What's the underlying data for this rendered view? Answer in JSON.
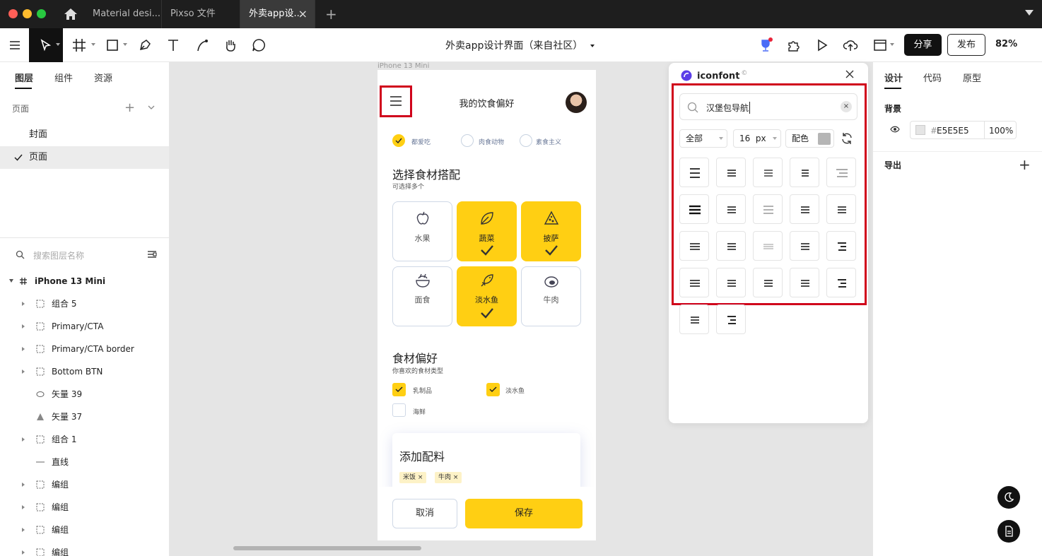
{
  "window": {
    "tabs": [
      {
        "label": "Material desi..."
      },
      {
        "label": "Pixso 文件"
      },
      {
        "label": "外卖app设...",
        "close": "×"
      }
    ],
    "new_tab": "+"
  },
  "toolbar": {
    "doc_title": "外卖app设计界面（来自社区）",
    "share_label": "分享",
    "publish_label": "发布",
    "zoom": "82%"
  },
  "left_panel": {
    "tabs": [
      "图层",
      "组件",
      "资源"
    ],
    "pages_header": "页面",
    "pages_add": "+",
    "pages": [
      "封面",
      "页面"
    ],
    "search_placeholder": "搜索图层名称",
    "layers": [
      {
        "name": "iPhone 13 Mini"
      },
      {
        "name": "组合 5"
      },
      {
        "name": "Primary/CTA"
      },
      {
        "name": "Primary/CTA border"
      },
      {
        "name": "Bottom BTN"
      },
      {
        "name": "矢量 39"
      },
      {
        "name": "矢量 37"
      },
      {
        "name": "组合 1"
      },
      {
        "name": "直线"
      },
      {
        "name": "编组"
      },
      {
        "name": "编组"
      },
      {
        "name": "编组"
      },
      {
        "name": "编组"
      }
    ]
  },
  "canvas": {
    "frame_label": "iPhone 13 Mini",
    "phone": {
      "title": "我的饮食偏好",
      "diet_options": [
        {
          "label": "都爱吃",
          "selected": true
        },
        {
          "label": "肉食动物",
          "selected": false
        },
        {
          "label": "素食主义",
          "selected": false
        }
      ],
      "ingredients_title": "选择食材搭配",
      "ingredients_sub": "可选择多个",
      "ingredients": [
        {
          "label": "水果",
          "icon": "apple-icon",
          "selected": false
        },
        {
          "label": "蔬菜",
          "icon": "leaf-icon",
          "selected": true
        },
        {
          "label": "披萨",
          "icon": "pizza-icon",
          "selected": true
        },
        {
          "label": "面食",
          "icon": "noodle-bowl-icon",
          "selected": false
        },
        {
          "label": "淡水鱼",
          "icon": "fish-icon",
          "selected": true
        },
        {
          "label": "牛肉",
          "icon": "steak-icon",
          "selected": false
        }
      ],
      "prefs_title": "食材偏好",
      "prefs_sub": "你喜欢的食材类型",
      "prefs": [
        {
          "label": "乳制品",
          "checked": true
        },
        {
          "label": "淡水鱼",
          "checked": true
        },
        {
          "label": "海鲜",
          "checked": false
        }
      ],
      "addon_title": "添加配料",
      "addon_chips": [
        "米饭",
        "牛肉"
      ],
      "chip_remove": "×",
      "cancel_label": "取消",
      "save_label": "保存"
    }
  },
  "plugin": {
    "title": "iconfont",
    "title_mark": "©",
    "search_value": "汉堡包导航",
    "clear_label": "×",
    "filter_all": "全部",
    "size_value": "16",
    "size_unit": "px",
    "color_label": "配色",
    "icon_count": 22
  },
  "right_panel": {
    "tabs": [
      "设计",
      "代码",
      "原型"
    ],
    "background_title": "背景",
    "hash": "#",
    "bg_hex": "E5E5E5",
    "bg_opacity": "100%",
    "export_title": "导出",
    "export_add": "+"
  },
  "colors": {
    "accent_yellow": "#FFCF13",
    "highlight_red": "#D0021B",
    "titlebar": "#1E1E1E",
    "canvas": "#E5E5E5"
  }
}
